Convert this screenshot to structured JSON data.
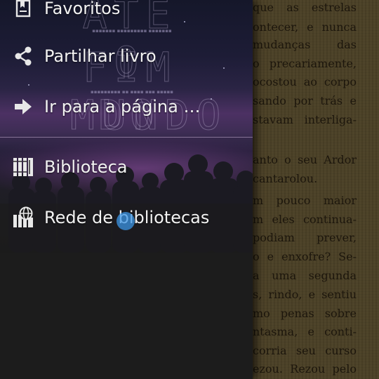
{
  "drawer": {
    "items": [
      {
        "label": "Favoritos",
        "icon": "bookmarks-icon"
      },
      {
        "label": "Partilhar livro",
        "icon": "share-icon"
      },
      {
        "label": "Ir para a página …",
        "icon": "arrow-right-icon"
      },
      {
        "label": "Biblioteca",
        "icon": "library-icon"
      },
      {
        "label": "Rede de bibliotecas",
        "icon": "network-library-icon"
      }
    ]
  },
  "book_page": {
    "lines": [
      "que as estrelas",
      "ontecer, e nunca",
      "mudanças das",
      "o precariamente,",
      "ocostou ao corpo",
      "sando por trás e",
      "stavam interliga-",
      "",
      "anto o seu Ardor",
      "cantarolou.",
      "m pouco maior",
      "m eles continua-",
      "podiam prever,",
      "o e enxofre? Se-",
      "a uma segunda",
      "s, rindo, e sentiu",
      "mo penas sobre",
      "ntasma, e conti-",
      "corria seu curso",
      "ezou. Rezou pelo"
    ]
  },
  "colors": {
    "drawer_bg": "#1c1c1c",
    "page_bg": "#4b4026",
    "touch_indicator": "#3c96e6"
  }
}
